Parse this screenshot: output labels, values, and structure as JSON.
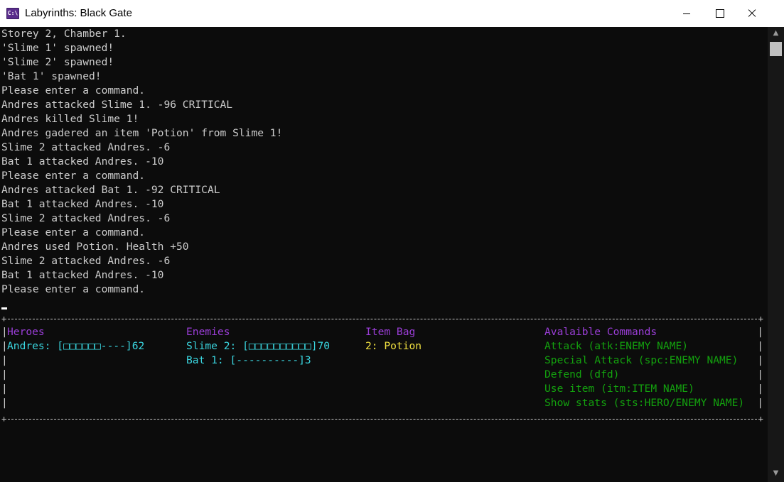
{
  "window": {
    "title": "Labyrinths: Black Gate",
    "icon_label": "C:\\"
  },
  "log": [
    "Storey 2, Chamber 1.",
    "'Slime 1' spawned!",
    "'Slime 2' spawned!",
    "'Bat 1' spawned!",
    "Please enter a command.",
    "Andres attacked Slime 1. -96 CRITICAL",
    "Andres killed Slime 1!",
    "Andres gadered an item 'Potion' from Slime 1!",
    "Slime 2 attacked Andres. -6",
    "Bat 1 attacked Andres. -10",
    "Please enter a command.",
    "Andres attacked Bat 1. -92 CRITICAL",
    "Bat 1 attacked Andres. -10",
    "Slime 2 attacked Andres. -6",
    "Please enter a command.",
    "Andres used Potion. Health +50",
    "Slime 2 attacked Andres. -6",
    "Bat 1 attacked Andres. -10",
    "Please enter a command."
  ],
  "hud": {
    "corner": "+",
    "pipe": "|",
    "heroes": {
      "header": "Heroes",
      "rows": [
        "Andres: [□□□□□□----]62"
      ]
    },
    "enemies": {
      "header": "Enemies",
      "rows": [
        "Slime 2: [□□□□□□□□□□]70",
        "Bat 1: [----------]3"
      ]
    },
    "items": {
      "header": "Item Bag",
      "rows": [
        "2: Potion"
      ]
    },
    "commands": {
      "header": "Avalaible Commands",
      "rows": [
        "Attack (atk:ENEMY NAME)",
        "Special Attack (spc:ENEMY NAME)",
        "Defend (dfd)",
        "Use item (itm:ITEM NAME)",
        "Show stats (sts:HERO/ENEMY NAME)"
      ]
    }
  },
  "scrollbar": {
    "up_arrow": "▲",
    "down_arrow": "▼"
  },
  "colors": {
    "header": "#9b3ed8",
    "heroes_enemies": "#3ad6e0",
    "items": "#f0e040",
    "commands": "#13a10e",
    "log_text": "#cccccc"
  }
}
